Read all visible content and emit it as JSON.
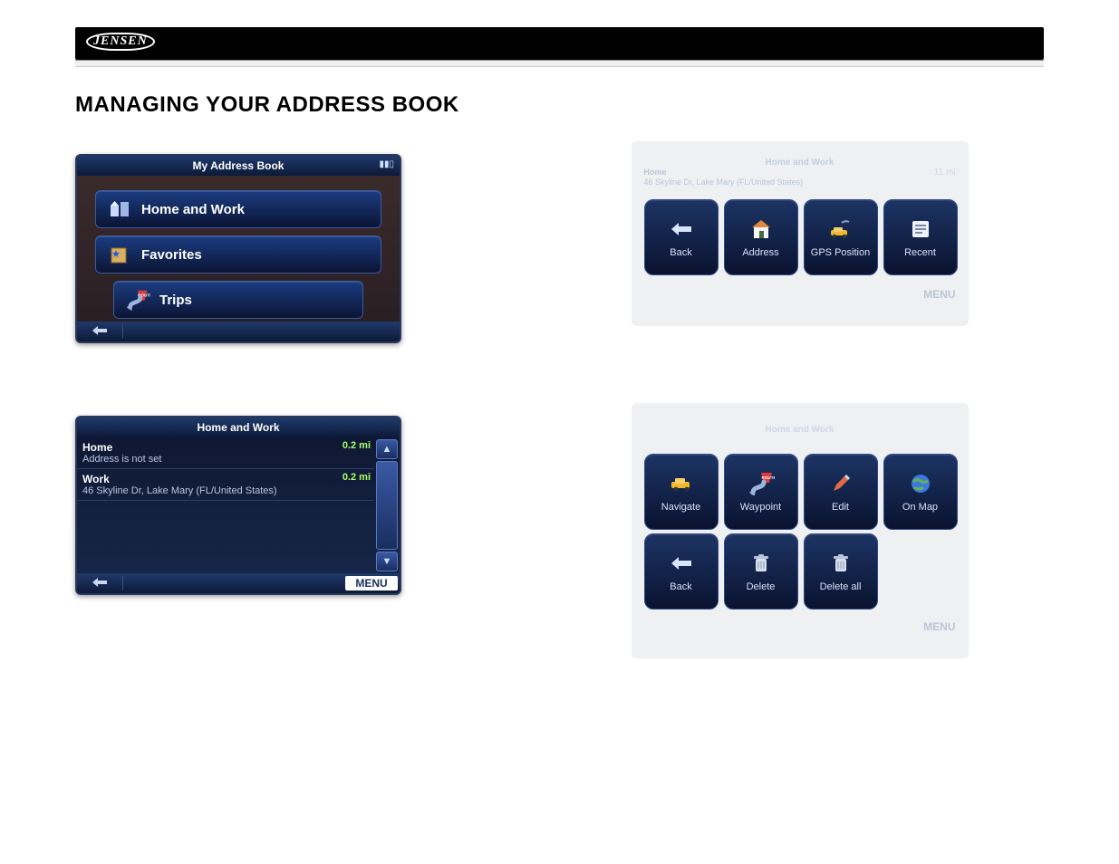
{
  "brand": "JENSEN",
  "section_title": "MANAGING YOUR ADDRESS BOOK",
  "screen_address_book": {
    "title": "My Address Book",
    "items": {
      "home_work": "Home and Work",
      "favorites": "Favorites",
      "trips": "Trips"
    }
  },
  "screen_home_work_list": {
    "title": "Home and Work",
    "rows": [
      {
        "name": "Home",
        "sub": "Address is not set",
        "dist": "0.2 mi"
      },
      {
        "name": "Work",
        "sub": "46 Skyline Dr, Lake Mary (FL/United States)",
        "dist": "0.2 mi"
      }
    ],
    "menu_label": "MENU"
  },
  "panel_set_location": {
    "header_title": "Home and Work",
    "header_subtitle": "46 Skyline Dr, Lake Mary (FL/United States)",
    "header_right": "11 mi",
    "tiles": {
      "back": "Back",
      "address": "Address",
      "gps": "GPS Position",
      "recent": "Recent"
    },
    "menu_label": "MENU"
  },
  "panel_actions": {
    "header_title": "Home and Work",
    "tiles": {
      "navigate": "Navigate",
      "waypoint": "Waypoint",
      "edit": "Edit",
      "on_map": "On Map",
      "back": "Back",
      "delete": "Delete",
      "delete_all": "Delete all"
    },
    "menu_label": "MENU"
  },
  "icons": {
    "route_badge": "ROUTE"
  }
}
